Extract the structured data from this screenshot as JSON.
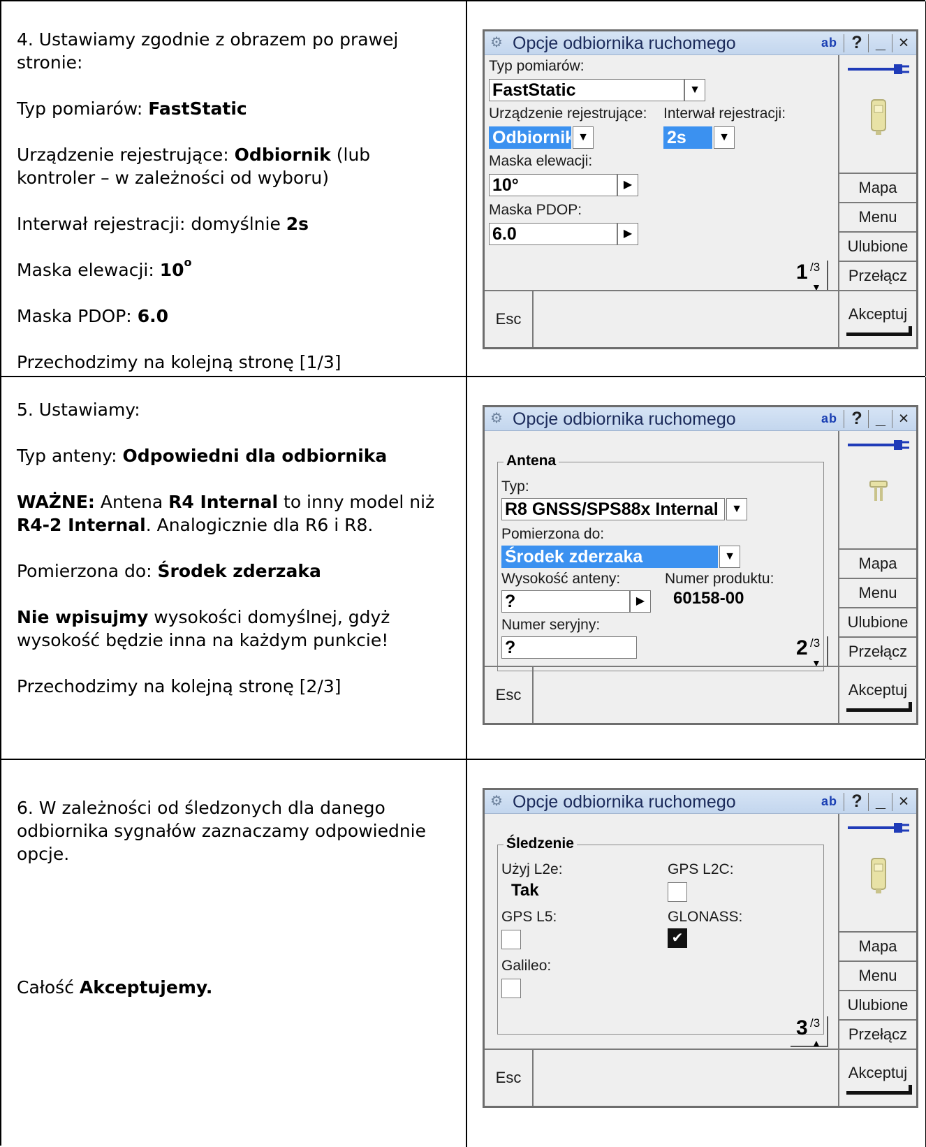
{
  "rows": [
    {
      "text": {
        "line1": "4. Ustawiamy zgodnie z obrazem po prawej stronie:",
        "typ_label": "Typ pomiarów:",
        "typ_value": "FastStatic",
        "urz_label": "Urządzenie rejestrujące:",
        "urz_value": "Odbiornik",
        "urz_note": "(lub kontroler – w zależności od wyboru)",
        "int_label": "Interwał rejestracji: domyślnie",
        "int_value": "2s",
        "mel_label": "Maska elewacji:",
        "mel_value": "10",
        "mel_sup": "o",
        "pdop_label": "Maska PDOP:",
        "pdop_value": "6.0",
        "next": "Przechodzimy na kolejną stronę [1/3]"
      },
      "window": {
        "fields": {
          "typ_label": "Typ pomiarów:",
          "typ_value": "FastStatic",
          "urz_label": "Urządzenie rejestrujące:",
          "urz_value": "Odbiornik",
          "int_label": "Interwał rejestracji:",
          "int_value": "2s",
          "mel_label": "Maska elewacji:",
          "mel_value": "10°",
          "pdop_label": "Maska PDOP:",
          "pdop_value": "6.0"
        },
        "page_num": "1",
        "page_den": "/3"
      }
    },
    {
      "text": {
        "line1": "5. Ustawiamy:",
        "typ_label": "Typ anteny:",
        "typ_value": "Odpowiedni dla odbiornika",
        "wazne": "WAŻNE:",
        "wazne_t1": "Antena",
        "wazne_b1": "R4 Internal",
        "wazne_t2": "to inny model niż",
        "wazne_b2": "R4-2 Internal",
        "wazne_t3": ". Analogicznie dla R6 i R8.",
        "pom_label": "Pomierzona do:",
        "pom_value": "Środek zderzaka",
        "nie_b": "Nie wpisujmy",
        "nie_t": "wysokości domyślnej, gdyż wysokość będzie inna na każdym punkcie!",
        "next": "Przechodzimy na kolejną stronę [2/3]"
      },
      "window": {
        "group": "Antena",
        "fields": {
          "typ_label": "Typ:",
          "typ_value": "R8 GNSS/SPS88x Internal",
          "pom_label": "Pomierzona do:",
          "pom_value": "Środek zderzaka",
          "wys_label": "Wysokość anteny:",
          "wys_value": "?",
          "prod_label": "Numer produktu:",
          "prod_value": "60158-00",
          "ser_label": "Numer seryjny:",
          "ser_value": "?"
        },
        "page_num": "2",
        "page_den": "/3"
      }
    },
    {
      "text": {
        "line1": "6. W zależności od śledzonych dla danego odbiornika sygnałów zaznaczamy odpowiednie opcje.",
        "acc_t": "Całość",
        "acc_b": "Akceptujemy."
      },
      "window": {
        "group": "Śledzenie",
        "fields": {
          "l2e_label": "Użyj L2e:",
          "l2e_value": "Tak",
          "l2c_label": "GPS L2C:",
          "l5_label": "GPS L5:",
          "glo_label": "GLONASS:",
          "gal_label": "Galileo:"
        },
        "checks": {
          "l2c": false,
          "l5": false,
          "glonass": true,
          "galileo": false
        },
        "page_num": "3",
        "page_den": "/3"
      }
    }
  ],
  "window_common": {
    "title": "Opcje odbiornika ruchomego",
    "ab": "ab",
    "help": "?",
    "minimize": "_",
    "close": "×",
    "side": {
      "mapa": "Mapa",
      "menu": "Menu",
      "ulubione": "Ulubione",
      "przelacz": "Przełącz",
      "akceptuj": "Akceptuj"
    },
    "esc": "Esc"
  }
}
